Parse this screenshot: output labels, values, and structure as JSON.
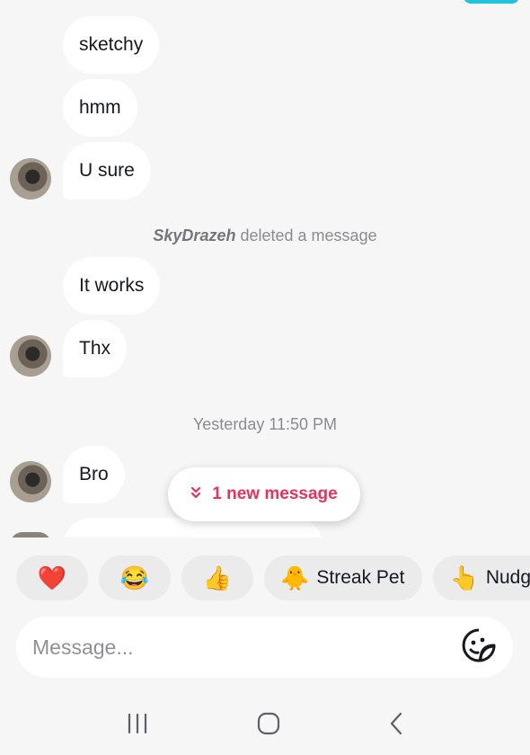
{
  "messages": [
    {
      "text": "sketchy"
    },
    {
      "text": "hmm"
    },
    {
      "text": "U sure"
    },
    {
      "text": "It works"
    },
    {
      "text": "Thx"
    },
    {
      "text": "Bro"
    }
  ],
  "system_notice": {
    "username": "SkyDrazeh",
    "action": "deleted a message"
  },
  "timestamp": "Yesterday 11:50 PM",
  "new_message_pill": {
    "label": "1 new message",
    "icon": "double-chevron-down-icon"
  },
  "quick_replies": [
    {
      "emoji": "❤️",
      "icon": "heart-icon"
    },
    {
      "emoji": "😂",
      "icon": "laughing-emoji-icon"
    },
    {
      "emoji": "👍",
      "icon": "thumbs-up-icon"
    },
    {
      "emoji": "🐥",
      "label": "Streak Pet",
      "icon": "streak-pet-icon"
    },
    {
      "emoji": "👆",
      "label": "Nudg",
      "icon": "pointing-hand-icon"
    }
  ],
  "composer": {
    "placeholder": "Message...",
    "icon": "sticker-icon"
  },
  "colors": {
    "accent": "#e8315b",
    "background": "#f6f6f6",
    "bubble": "#ffffff",
    "chip": "#ebebeb"
  },
  "system_nav": [
    "recents-icon",
    "home-icon",
    "back-icon"
  ]
}
